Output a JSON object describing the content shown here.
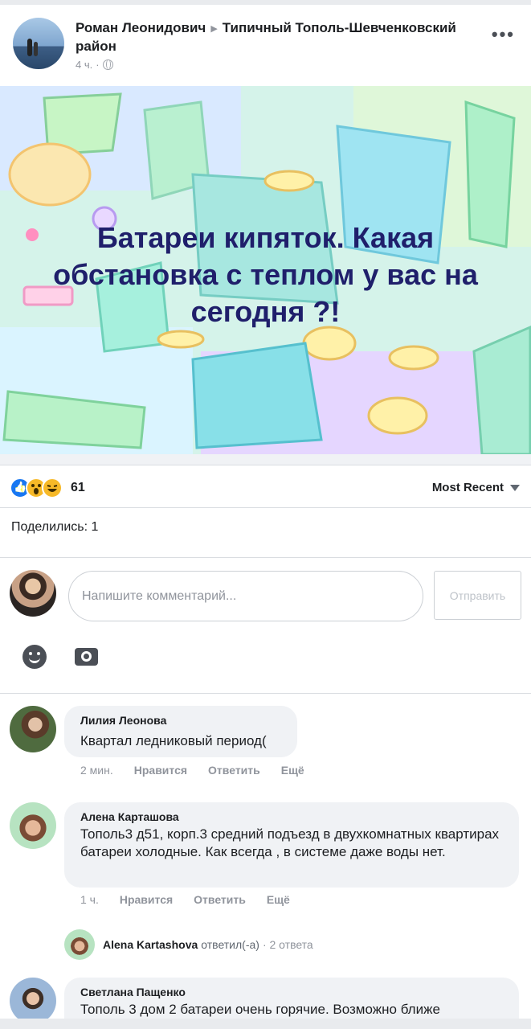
{
  "post": {
    "author": "Роман Леонидович",
    "group": "Типичный Тополь-Шевченковский район",
    "time": "4 ч.",
    "text": "Батареи кипяток. Какая обстановка с теплом у вас на сегодня ?!",
    "reaction_count": "61",
    "sort_label": "Most Recent",
    "shares": "Поделились: 1"
  },
  "composer": {
    "placeholder": "Напишите комментарий...",
    "send_label": "Отправить"
  },
  "comments": [
    {
      "name": "Лилия Леонова",
      "text": "Квартал ледниковый период(",
      "time": "2 мин.",
      "like": "Нравится",
      "reply": "Ответить",
      "more": "Ещё"
    },
    {
      "name": "Алена Карташова",
      "text": "Тополь3 д51, корп.3 средний подъезд в двухкомнатных квартирах батареи холодные. Как всегда , в системе даже воды нет.",
      "time": "1 ч.",
      "like": "Нравится",
      "reply": "Ответить",
      "more": "Ещё",
      "replies": {
        "name": "Alena Kartashova",
        "verb": "ответил(-а)",
        "count": "· 2 ответа"
      }
    },
    {
      "name": "Светлана Пащенко",
      "text": "Тополь 3 дом 2 батареи очень горячие. Возможно ближе"
    }
  ],
  "colors": {
    "text_primary": "#1c1e21",
    "text_secondary": "#90949c",
    "bubble_bg": "#f0f2f5",
    "post_text": "#1f1f6b",
    "like_blue": "#1877f2"
  }
}
